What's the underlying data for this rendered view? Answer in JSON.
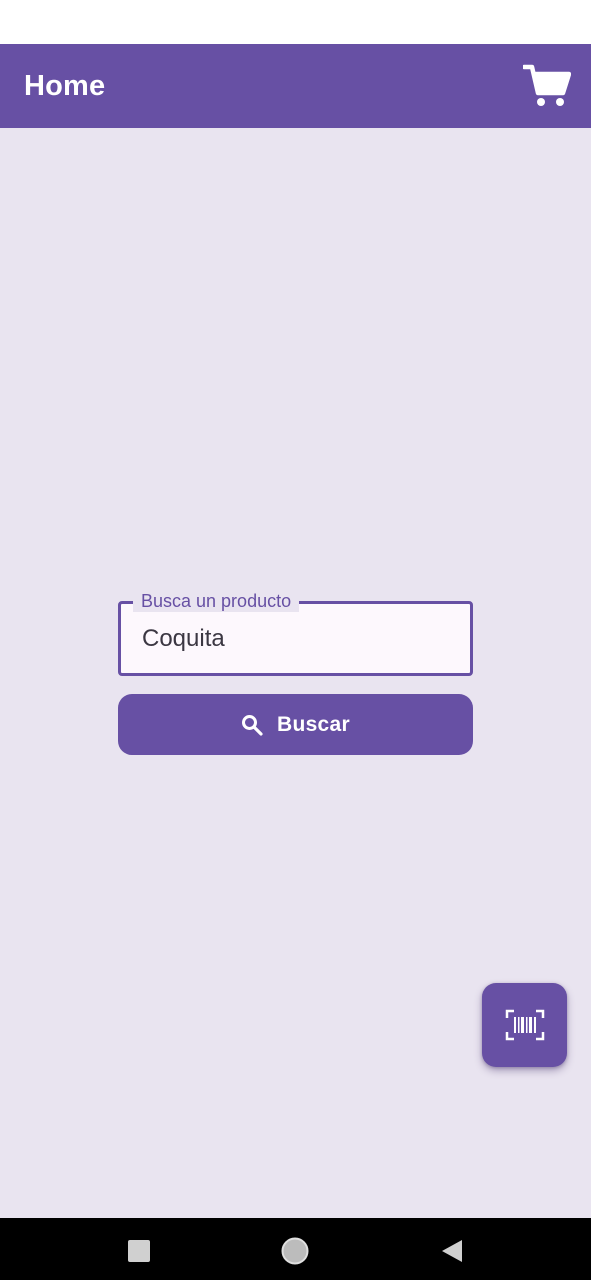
{
  "app_bar": {
    "title": "Home",
    "cart_icon": "shopping-cart-icon",
    "background_color": "#6750a4"
  },
  "search": {
    "label": "Busca un producto",
    "value": "Coquita",
    "button_label": "Buscar",
    "button_icon": "search-icon"
  },
  "fab": {
    "icon": "barcode-scan-icon"
  },
  "system_nav": {
    "recents_icon": "square-recents-icon",
    "home_icon": "circle-home-icon",
    "back_icon": "triangle-back-icon"
  },
  "colors": {
    "primary": "#6750a4",
    "background": "#e9e4f0",
    "field_fill": "#fdf8fd",
    "on_primary": "#ffffff"
  }
}
